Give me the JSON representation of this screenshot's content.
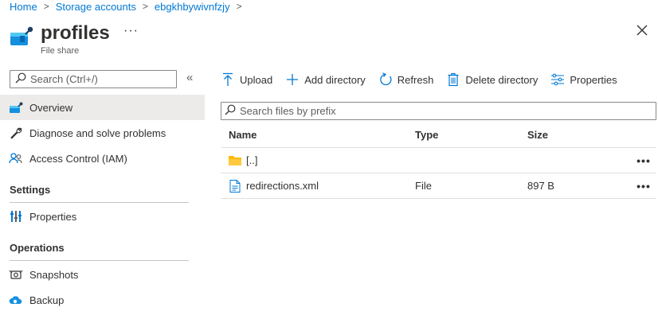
{
  "breadcrumb": {
    "items": [
      "Home",
      "Storage accounts",
      "ebgkhbywivnfzjy"
    ],
    "separator": ">"
  },
  "header": {
    "title": "profiles",
    "subtitle": "File share",
    "more_label": "···",
    "icon": "file-share-icon"
  },
  "sidebar": {
    "search_placeholder": "Search (Ctrl+/)",
    "collapse_glyph": "«",
    "items": [
      {
        "label": "Overview",
        "icon": "overview-icon",
        "selected": true
      },
      {
        "label": "Diagnose and solve problems",
        "icon": "wrench-icon"
      },
      {
        "label": "Access Control (IAM)",
        "icon": "people-icon"
      }
    ],
    "sections": [
      {
        "title": "Settings",
        "items": [
          {
            "label": "Properties",
            "icon": "properties-icon"
          }
        ]
      },
      {
        "title": "Operations",
        "items": [
          {
            "label": "Snapshots",
            "icon": "snapshots-icon"
          },
          {
            "label": "Backup",
            "icon": "backup-icon"
          }
        ]
      }
    ]
  },
  "toolbar": {
    "upload": "Upload",
    "add_directory": "Add directory",
    "refresh": "Refresh",
    "delete_directory": "Delete directory",
    "properties": "Properties"
  },
  "file_search": {
    "placeholder": "Search files by prefix"
  },
  "grid": {
    "columns": [
      "Name",
      "Type",
      "Size"
    ],
    "rows": [
      {
        "name": "[..]",
        "type": "",
        "size": "",
        "icon": "folder-icon"
      },
      {
        "name": "redirections.xml",
        "type": "File",
        "size": "897 B",
        "icon": "file-icon"
      }
    ],
    "more_glyph": "•••"
  },
  "colors": {
    "accent": "#0078d4",
    "selected_bg": "#edebe9",
    "folder": "#ffb900"
  }
}
